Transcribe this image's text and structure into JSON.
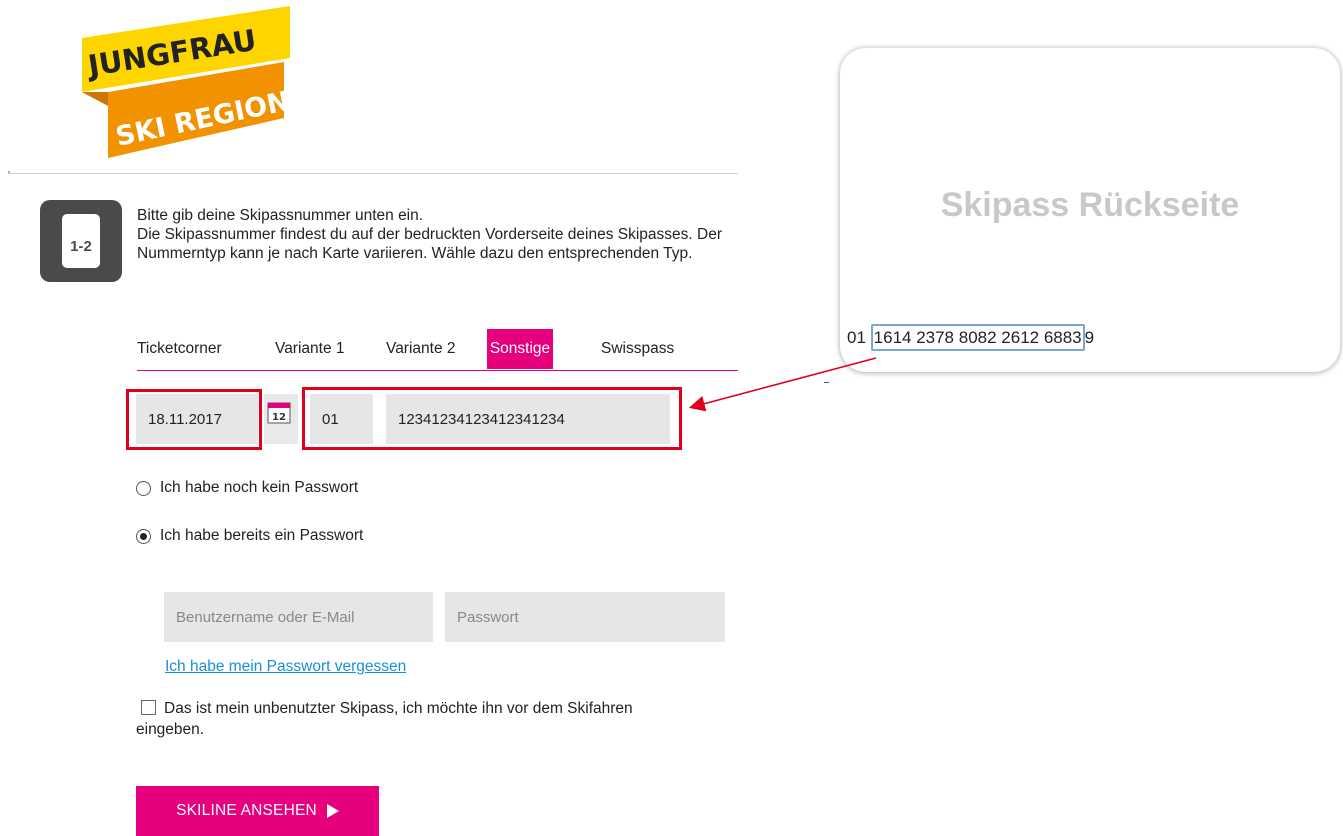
{
  "logo": {
    "line1": "JUNGFRAU",
    "line2": "SKI REGION"
  },
  "step": {
    "label": "1-2"
  },
  "instructions": {
    "line1": "Bitte gib deine Skipassnummer unten ein.",
    "line2": "Die Skipassnummer findest du auf der bedruckten Vorderseite deines Skipasses. Der Nummerntyp kann je nach Karte variieren. Wähle dazu den entsprechenden Typ."
  },
  "tabs": [
    {
      "label": "Ticketcorner"
    },
    {
      "label": "Variante 1"
    },
    {
      "label": "Variante 2"
    },
    {
      "label": "Sonstige",
      "active": true
    },
    {
      "label": "Swisspass"
    }
  ],
  "form": {
    "date_value": "18.11.2017",
    "calendar_day": "12",
    "prefix_value": "01",
    "number_value": "12341234123412341234",
    "radio_no_password": "Ich habe noch kein Passwort",
    "radio_has_password": "Ich habe bereits ein Passwort",
    "username_placeholder": "Benutzername oder E-Mail",
    "password_placeholder": "Passwort",
    "forgot_link": "Ich habe mein Passwort vergessen",
    "unused_checkbox_label": "Das ist mein unbenutzter Skipass, ich möchte ihn vor dem Skifahren eingeben.",
    "submit_label": "SKILINE ANSEHEN"
  },
  "card": {
    "title": "Skipass Rückseite",
    "number_prefix": "01",
    "number_highlight": "1614 2378 8082 2612 6883",
    "number_suffix": "9"
  },
  "colors": {
    "accent": "#e6007e",
    "highlight_red": "#e0001b",
    "link_blue": "#1a8fd8",
    "field_gray": "#e6e6e6"
  }
}
